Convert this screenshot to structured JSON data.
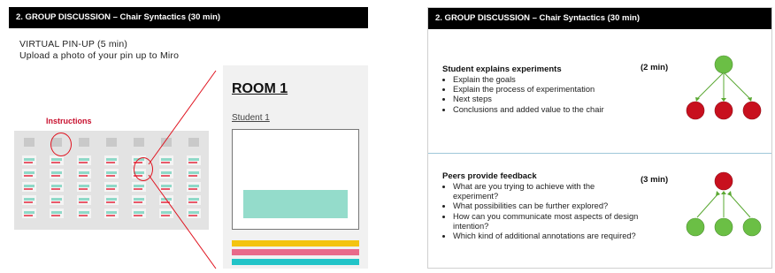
{
  "slides": {
    "left": {
      "header": "2. GROUP DISCUSSION – Chair Syntactics (30 min)",
      "pinup_title": "VIRTUAL PIN-UP (5 min)",
      "pinup_text": "Upload a photo of your pin up to Miro",
      "instructions_label": "Instructions",
      "room_title": "ROOM 1",
      "student_label": "Student 1"
    },
    "right": {
      "header": "2. GROUP DISCUSSION – Chair Syntactics (30 min)",
      "section1": {
        "heading": "Student explains experiments",
        "time": "(2 min)",
        "bullets": [
          "Explain the goals",
          "Explain the process of experimentation",
          "Next steps",
          "Conclusions and added value to the chair"
        ]
      },
      "section2": {
        "heading": "Peers provide feedback",
        "time": "(3 min)",
        "bullets": [
          "What are you trying to achieve with the experiment?",
          "What possibilities can be further explored?",
          "How can you communicate most aspects of design intention?",
          "Which kind of additional annotations are required?"
        ]
      }
    }
  },
  "colors": {
    "header_bg": "#000000",
    "instructions_red": "#c8102e",
    "node_green": "#6bbf45",
    "node_red": "#c8101e",
    "arrow_green": "#5aa832",
    "teal": "#94dccb"
  }
}
